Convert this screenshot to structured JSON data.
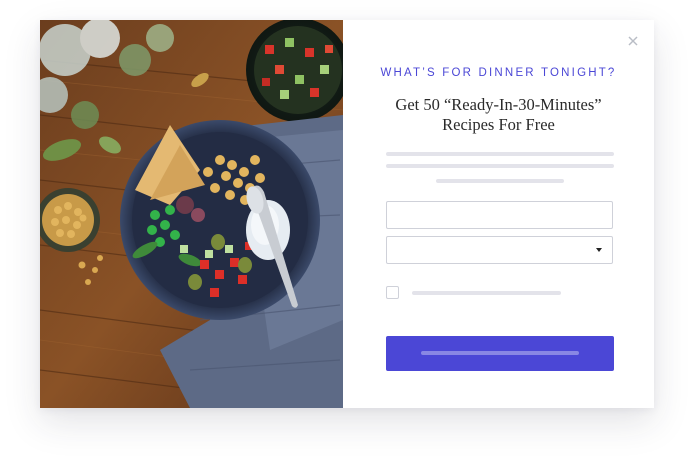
{
  "popup": {
    "eyebrow": "WHAT’S FOR DINNER TONIGHT?",
    "headline": "Get 50 “Ready-In-30-Minutes” Recipes For Free",
    "close_icon": "close-icon",
    "accent_color": "#4b47d6"
  },
  "form": {
    "email_value": "",
    "select_value": "",
    "consent_checked": false,
    "submit_label": ""
  },
  "image": {
    "subject": "dinner-bowl-photo"
  }
}
